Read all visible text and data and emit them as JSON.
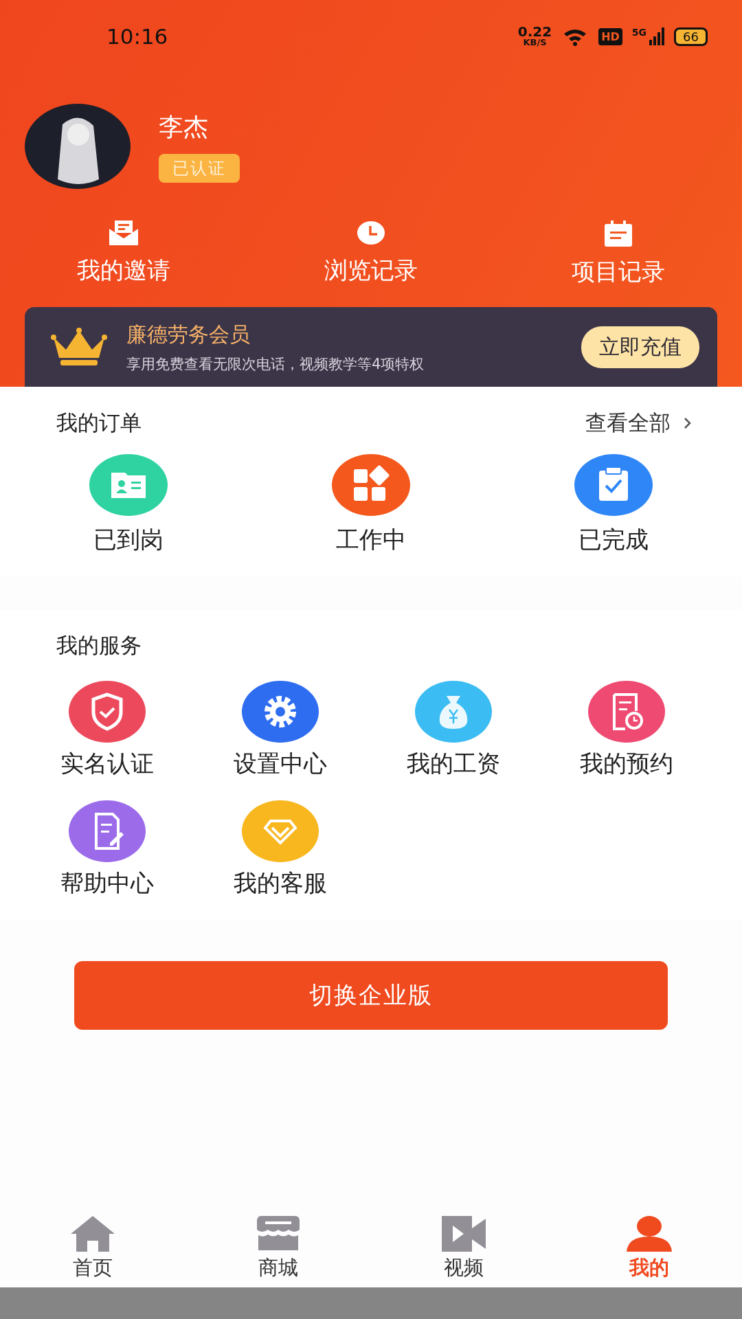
{
  "status_bar": {
    "time": "10:16",
    "net_speed": "0.22",
    "net_unit": "KB/S",
    "hd": "HD",
    "network": "5G",
    "battery": "66"
  },
  "profile": {
    "name": "李杰",
    "badge": "已认证"
  },
  "shortcuts": [
    {
      "kind": "mail",
      "label": "我的邀请"
    },
    {
      "kind": "clock",
      "label": "浏览记录"
    },
    {
      "kind": "calendar",
      "label": "项目记录"
    }
  ],
  "membership": {
    "title": "廉德劳务会员",
    "subtitle": "享用免费查看无限次电话，视频教学等4项特权",
    "button": "立即充值"
  },
  "orders": {
    "title": "我的订单",
    "view_all": "查看全部",
    "items": [
      {
        "kind": "id-card",
        "label": "已到岗",
        "color": "#2fd3a2"
      },
      {
        "kind": "blocks",
        "label": "工作中",
        "color": "#f4581c"
      },
      {
        "kind": "clipboard",
        "label": "已完成",
        "color": "#2f86f6"
      }
    ]
  },
  "services": {
    "title": "我的服务",
    "items": [
      {
        "kind": "shield",
        "label": "实名认证",
        "color": "#ec4a5c"
      },
      {
        "kind": "gear",
        "label": "设置中心",
        "color": "#2f6df0"
      },
      {
        "kind": "money-bag",
        "label": "我的工资",
        "color": "#3bbcf2"
      },
      {
        "kind": "schedule",
        "label": "我的预约",
        "color": "#ee4a72"
      },
      {
        "kind": "document",
        "label": "帮助中心",
        "color": "#9b6bea"
      },
      {
        "kind": "heart-gem",
        "label": "我的客服",
        "color": "#f8b71f"
      }
    ]
  },
  "switch_button": "切换企业版",
  "tabs": [
    {
      "kind": "home",
      "label": "首页",
      "selected": false
    },
    {
      "kind": "shop",
      "label": "商城",
      "selected": false
    },
    {
      "kind": "video",
      "label": "视频",
      "selected": false
    },
    {
      "kind": "person",
      "label": "我的",
      "selected": true
    }
  ]
}
